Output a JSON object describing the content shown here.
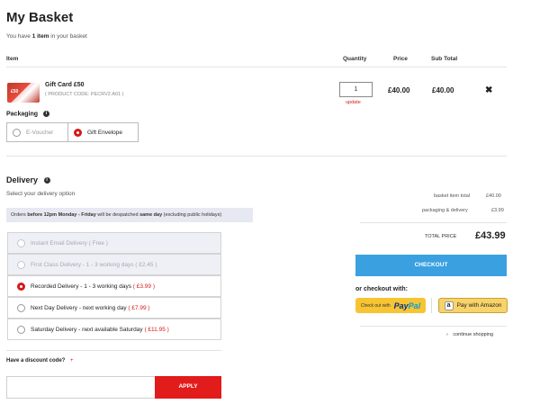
{
  "page": {
    "title": "My Basket",
    "summary_prefix": "You have ",
    "summary_count": "1 item",
    "summary_suffix": " in your basket"
  },
  "table": {
    "headers": {
      "item": "Item",
      "quantity": "Quantity",
      "price": "Price",
      "subtotal": "Sub Total"
    },
    "rows": [
      {
        "thumb_text": "£50",
        "name": "Gift Card £50",
        "code": "( PRODUCT CODE: PECRV2.A01 )",
        "quantity": "1",
        "update_label": "update",
        "price": "£40.00",
        "subtotal": "£40.00",
        "remove_glyph": "✖"
      }
    ]
  },
  "packaging": {
    "label": "Packaging",
    "options": [
      {
        "label": "E-Voucher",
        "selected": false
      },
      {
        "label": "Gift Envelope",
        "selected": true
      }
    ]
  },
  "delivery": {
    "title": "Delivery",
    "subtitle": "Select your delivery option",
    "notice": {
      "prefix": "Orders ",
      "bold1": "before 12pm Monday - Friday",
      "middle": " will be despatched ",
      "bold2": "same day",
      "suffix": " (excluding public holidays)"
    },
    "options": [
      {
        "label": "Instant Email Delivery",
        "price": " ( Free )",
        "state": "disabled"
      },
      {
        "label": "First Class Delivery - 1 - 3 working days",
        "price": " ( £2.45 )",
        "state": "disabled"
      },
      {
        "label": "Recorded Delivery - 1 - 3 working days",
        "price": " ( £3.99 )",
        "state": "selected"
      },
      {
        "label": "Next Day Delivery - next working day",
        "price": " ( £7.99 )",
        "state": "normal"
      },
      {
        "label": "Saturday Delivery - next available Saturday",
        "price": " ( £11.95 )",
        "state": "normal"
      }
    ]
  },
  "totals": {
    "basket_label": "basket item total",
    "basket_value": "£40.00",
    "packaging_label": "packaging & delivery",
    "packaging_value": "£3.99",
    "total_label": "TOTAL PRICE",
    "total_value": "£43.99"
  },
  "checkout": {
    "button": "CHECKOUT",
    "or_label": "or checkout with:",
    "paypal_small": "Check out with",
    "paypal_logo_a": "Pay",
    "paypal_logo_b": "Pal",
    "amazon_label": "Pay with Amazon",
    "continue": "continue shopping"
  },
  "discount": {
    "label": "Have a discount code?",
    "toggle_glyph": "+",
    "input_value": "",
    "apply": "APPLY"
  },
  "colors": {
    "accent_red": "#d31a1a",
    "checkout_blue": "#3aa0e0",
    "paypal_yellow": "#f7c434",
    "amazon_yellow": "#f7d36a"
  }
}
